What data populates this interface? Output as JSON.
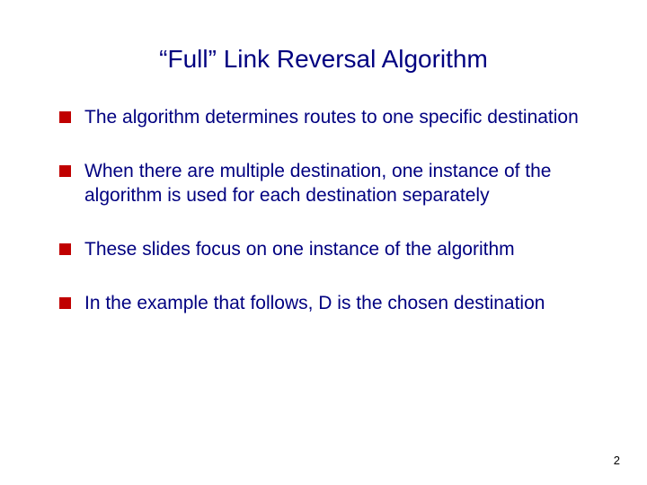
{
  "title": "“Full” Link Reversal Algorithm",
  "bullets": [
    "The algorithm determines routes to one specific destination",
    "When there are multiple destination, one instance of the algorithm is used for each destination separately",
    "These slides focus on one instance of the algorithm",
    "In the example that follows, D is the chosen destination"
  ],
  "page_number": "2"
}
